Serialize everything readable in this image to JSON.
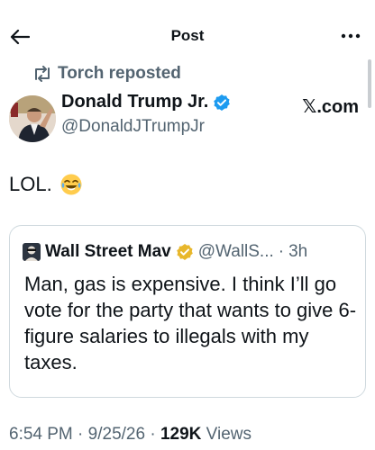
{
  "header": {
    "title": "Post"
  },
  "repost": {
    "label": "Torch reposted"
  },
  "author": {
    "name": "Donald Trump Jr.",
    "handle": "@DonaldJTrumpJr",
    "source": "𝕏.com",
    "verified_color": "#1d9bf0"
  },
  "tweet": {
    "text": "LOL."
  },
  "quote": {
    "name": "Wall Street Mav",
    "handle": "@WallS...",
    "separator": "·",
    "time": "3h",
    "text": "Man, gas is expensive. I think I’ll go vote for the party that wants to give 6-figure salaries to illegals with my taxes.",
    "verified_color": "#e8b72c"
  },
  "meta": {
    "time": "6:54 PM",
    "date": "9/25/26",
    "sep": "·",
    "views_count": "129K",
    "views_label": "Views"
  },
  "icons": {
    "back": "arrow-left-icon",
    "more": "more-dots-icon",
    "repost": "repost-icon",
    "verified": "verified-badge-icon",
    "emoji": "laughing-emoji-icon"
  }
}
